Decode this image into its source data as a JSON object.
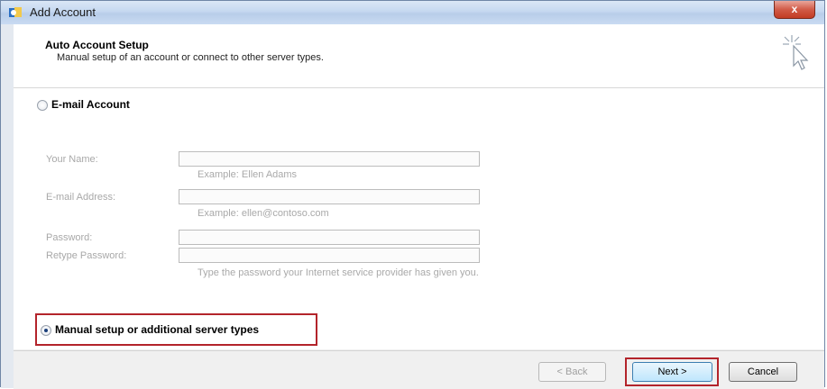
{
  "window": {
    "title": "Add Account",
    "close_label": "x"
  },
  "header": {
    "title": "Auto Account Setup",
    "subtitle": "Manual setup of an account or connect to other server types."
  },
  "email_account": {
    "label": "E-mail Account"
  },
  "form": {
    "your_name_label": "Your Name:",
    "your_name_value": "",
    "your_name_hint": "Example: Ellen Adams",
    "email_label": "E-mail Address:",
    "email_value": "",
    "email_hint": "Example: ellen@contoso.com",
    "password_label": "Password:",
    "retype_label": "Retype Password:",
    "password_hint": "Type the password your Internet service provider has given you."
  },
  "manual_setup": {
    "label": "Manual setup or additional server types",
    "selected": true
  },
  "footer": {
    "back_label": "< Back",
    "next_label": "Next >",
    "cancel_label": "Cancel"
  },
  "colors": {
    "highlight": "#b3242b",
    "titlebar": "#c5d8f0"
  }
}
